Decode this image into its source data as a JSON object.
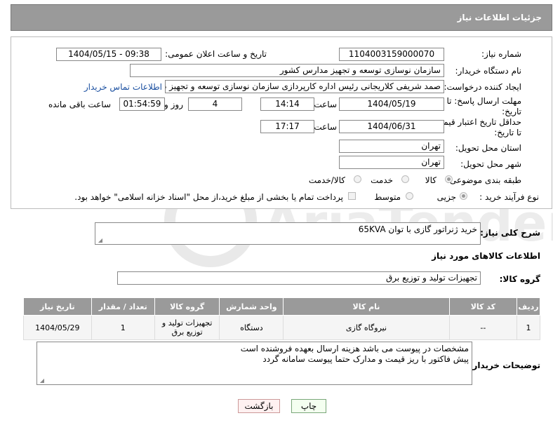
{
  "header": {
    "title": "جزئیات اطلاعات نیاز"
  },
  "form": {
    "need_number_label": "شماره نیاز:",
    "need_number": "1104003159000070",
    "announce_label": "تاریخ و ساعت اعلان عمومی:",
    "announce_value": "1404/05/15 - 09:38",
    "buyer_org_label": "نام دستگاه خریدار:",
    "buyer_org": "سازمان نوسازی  توسعه و تجهیز مدارس کشور",
    "creator_label": "ایجاد کننده درخواست:",
    "creator": "صمد شریفی کلاریجانی رئیس اداره کارپردازی سازمان نوسازی  توسعه و تجهیز د",
    "contact_link": "اطلاعات تماس خریدار",
    "deadline_label_1": "مهلت ارسال پاسخ: تا",
    "deadline_label_2": "تاریخ:",
    "deadline_date": "1404/05/19",
    "time_label": "ساعت",
    "deadline_time": "14:14",
    "days_value": "4",
    "days_label": "روز و",
    "remaining_time": "01:54:59",
    "remaining_label": "ساعت باقی مانده",
    "validity_label_1": "حداقل تاریخ اعتبار قیمت:",
    "validity_label_2": "تا تاریخ:",
    "validity_date": "1404/06/31",
    "validity_time_label": "ساعت",
    "validity_time": "17:17",
    "province_label": "استان محل تحویل:",
    "province": "تهران",
    "city_label": "شهر محل تحویل:",
    "city": "تهران",
    "category_label": "طبقه بندی موضوعی:",
    "category_options": [
      "کالا",
      "خدمت",
      "کالا/خدمت"
    ],
    "process_label": "نوع فرآیند خرید :",
    "process_options": [
      "جزیی",
      "متوسط"
    ],
    "payment_note": "پرداخت تمام یا بخشی از مبلغ خرید،از محل \"اسناد خزانه اسلامی\" خواهد بود."
  },
  "description": {
    "label": "شرح کلی نیاز:",
    "value": "خرید ژنراتور گازی با توان 65KVA"
  },
  "goods_section": {
    "title": "اطلاعات کالاهای مورد نیاز",
    "group_label": "گروه کالا:",
    "group_value": "تجهیزات تولید و توزیع برق"
  },
  "table": {
    "headers": [
      "ردیف",
      "کد کالا",
      "نام کالا",
      "واحد شمارش",
      "گروه کالا",
      "تعداد / مقدار",
      "تاریخ نیاز"
    ],
    "rows": [
      [
        "1",
        "--",
        "نیروگاه گازی",
        "دستگاه",
        "تجهیزات تولید و توزیع برق",
        "1",
        "1404/05/29"
      ]
    ]
  },
  "buyer_notes": {
    "label": "توضیحات خریدار:",
    "line1": "مشخصات در پیوست می باشد هزینه ارسال بعهده فروشنده است",
    "line2": "پیش فاکتور با ریز قیمت و مدارک حتما پیوست سامانه گردد"
  },
  "buttons": {
    "print": "چاپ",
    "back": "بازگشت"
  },
  "watermark": "AriaTender.net"
}
